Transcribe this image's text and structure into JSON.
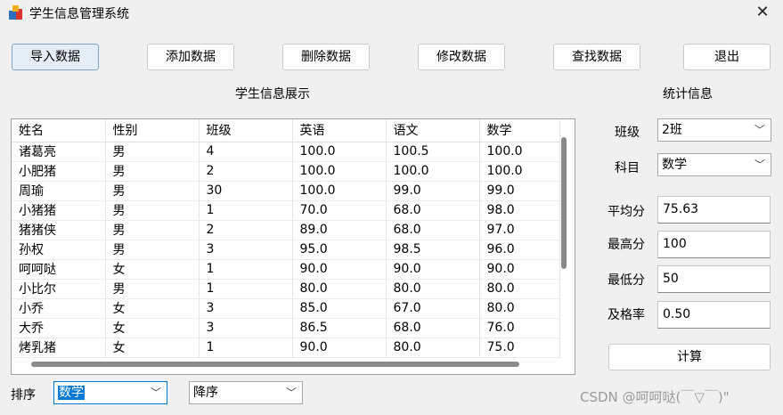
{
  "window": {
    "title": "学生信息管理系统"
  },
  "toolbar": {
    "import_label": "导入数据",
    "add_label": "添加数据",
    "delete_label": "删除数据",
    "edit_label": "修改数据",
    "search_label": "查找数据",
    "exit_label": "退出"
  },
  "display": {
    "heading": "学生信息展示"
  },
  "table": {
    "headers": [
      "姓名",
      "性别",
      "班级",
      "英语",
      "语文",
      "数学"
    ],
    "rows": [
      [
        "诸葛亮",
        "男",
        "4",
        "100.0",
        "100.5",
        "100.0"
      ],
      [
        "小肥猪",
        "男",
        "2",
        "100.0",
        "100.0",
        "100.0"
      ],
      [
        "周瑜",
        "男",
        "30",
        "100.0",
        "99.0",
        "99.0"
      ],
      [
        "小猪猪",
        "男",
        "1",
        "70.0",
        "68.0",
        "98.0"
      ],
      [
        "猪猪侠",
        "男",
        "2",
        "89.0",
        "68.0",
        "97.0"
      ],
      [
        "孙权",
        "男",
        "3",
        "95.0",
        "98.5",
        "96.0"
      ],
      [
        "呵呵哒",
        "女",
        "1",
        "90.0",
        "90.0",
        "90.0"
      ],
      [
        "小比尔",
        "男",
        "1",
        "80.0",
        "80.0",
        "80.0"
      ],
      [
        "小乔",
        "女",
        "3",
        "85.0",
        "67.0",
        "80.0"
      ],
      [
        "大乔",
        "女",
        "3",
        "86.5",
        "68.0",
        "76.0"
      ],
      [
        "烤乳猪",
        "女",
        "1",
        "90.0",
        "80.0",
        "75.0"
      ]
    ]
  },
  "sort": {
    "label": "排序",
    "field_value": "数学",
    "order_value": "降序"
  },
  "stats": {
    "heading": "统计信息",
    "class_label": "班级",
    "class_value": "2班",
    "subject_label": "科目",
    "subject_value": "数学",
    "avg_label": "平均分",
    "avg_value": "75.63",
    "max_label": "最高分",
    "max_value": "100",
    "min_label": "最低分",
    "min_value": "50",
    "pass_label": "及格率",
    "pass_value": "0.50",
    "compute_label": "计算"
  },
  "watermark": "CSDN @呵呵哒(￣▽￣)\"",
  "icons": {
    "app": "app-icon",
    "close": "close-icon",
    "dropdown": "chevron-down-icon"
  },
  "colors": {
    "selection": "#0078d7",
    "primary_button": "#e5eef7"
  }
}
